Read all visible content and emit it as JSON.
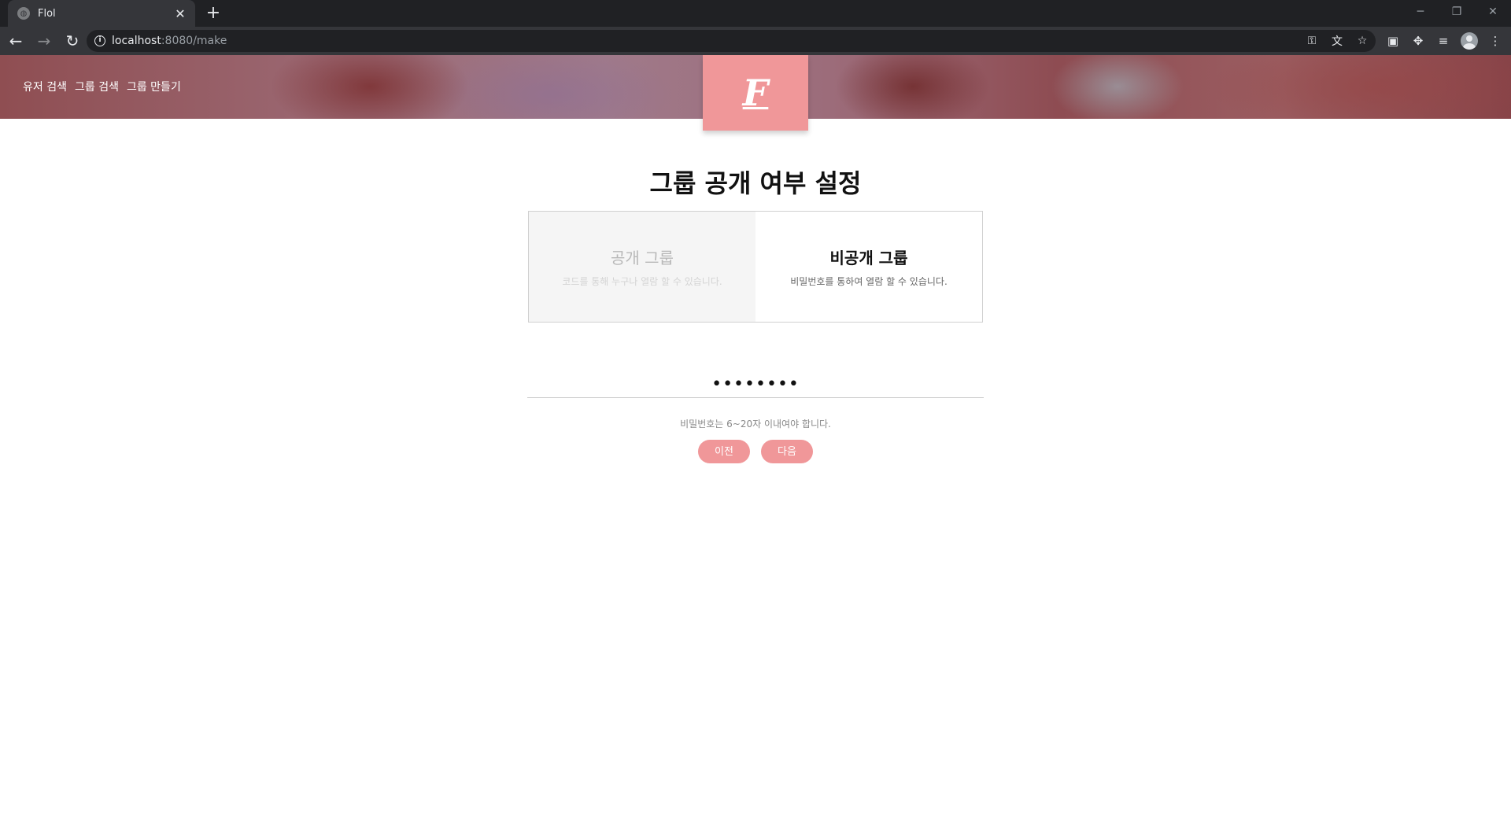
{
  "browser": {
    "tab_title": "Flol",
    "tab_close": "✕",
    "new_tab": "+",
    "url_host": "localhost",
    "url_rest": ":8080/make",
    "window_controls": {
      "minimize": "─",
      "restore": "❐",
      "close": "✕"
    },
    "icons": [
      "key-icon",
      "translate-icon",
      "star-icon",
      "extension-badge-icon",
      "puzzle-icon",
      "media-icon",
      "profile-icon",
      "menu-icon"
    ]
  },
  "nav": {
    "user_search": "유저 검색",
    "group_search": "그룹 검색",
    "group_create": "그룹 만들기"
  },
  "logo": {
    "letter": "F"
  },
  "page": {
    "title": "그룹 공개 여부 설정",
    "public_option": {
      "title": "공개 그룹",
      "desc": "코드를 통해 누구나 열람 할 수 있습니다."
    },
    "private_option": {
      "title": "비공개 그룹",
      "desc": "비밀번호를 통하여 열람 할 수 있습니다."
    },
    "selected": "private",
    "password_value": "••••••••",
    "password_hint": "비밀번호는 6~20자 이내여야 합니다.",
    "prev_button": "이전",
    "next_button": "다음"
  },
  "colors": {
    "accent": "#f09799",
    "chrome_dark": "#202124",
    "chrome_toolbar": "#35363a"
  }
}
